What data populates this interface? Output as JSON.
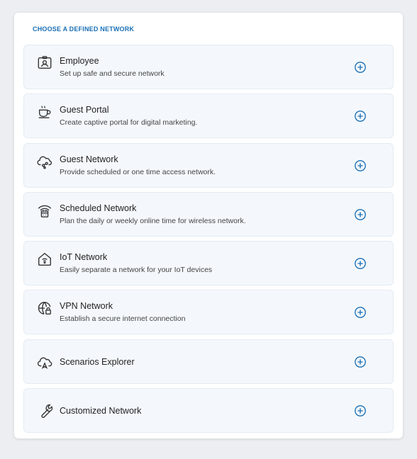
{
  "panel": {
    "heading": "CHOOSE A DEFINED NETWORK",
    "accent_color": "#1a6fb5",
    "items": [
      {
        "title": "Employee",
        "description": "Set up safe and secure network",
        "icon": "employee-badge-icon"
      },
      {
        "title": "Guest Portal",
        "description": "Create captive portal for digital marketing.",
        "icon": "coffee-cup-icon"
      },
      {
        "title": "Guest Network",
        "description": "Provide scheduled or one time access network.",
        "icon": "cloud-network-icon"
      },
      {
        "title": "Scheduled Network",
        "description": "Plan the daily or weekly online time for wireless network.",
        "icon": "wifi-calendar-icon"
      },
      {
        "title": "IoT Network",
        "description": "Easily separate a network for your IoT devices",
        "icon": "smart-home-icon"
      },
      {
        "title": "VPN Network",
        "description": "Establish a secure internet connection",
        "icon": "globe-lock-icon"
      },
      {
        "title": "Scenarios Explorer",
        "description": "",
        "icon": "cloud-explore-icon"
      },
      {
        "title": "Customized Network",
        "description": "",
        "icon": "wrench-icon"
      }
    ]
  }
}
